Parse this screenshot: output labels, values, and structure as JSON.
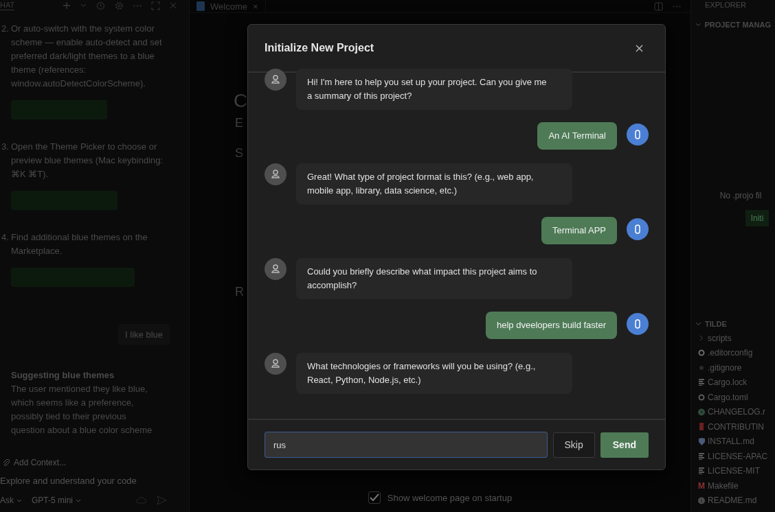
{
  "chat_panel": {
    "tab": "HAT",
    "steps": [
      {
        "number": "2.",
        "text": "Or auto-switch with the system color scheme — enable auto-detect and set preferred dark/light themes to a blue theme (references: window.autoDetectColorScheme)."
      },
      {
        "number": "3.",
        "text": "Open the Theme Picker to choose or preview blue themes (Mac keybinding: ⌘K ⌘T)."
      },
      {
        "number": "4.",
        "text": "Find additional blue themes on the Marketplace."
      }
    ],
    "user_message": "I like blue",
    "thinking": {
      "title": "Suggesting blue themes",
      "text": "The user mentioned they like blue, which seems like a preference, possibly tied to their previous question about a blue color scheme"
    },
    "add_context": "Add Context...",
    "input": {
      "placeholder": "Explore and understand your code"
    },
    "mode": "Ask",
    "model": "GPT-5 mini"
  },
  "editor": {
    "tab": {
      "label": "Welcome",
      "close": "×"
    },
    "fragments": [
      "C",
      "E",
      "S",
      "R"
    ],
    "show_on_startup": {
      "label": "Show welcome page on startup",
      "checked": true
    }
  },
  "explorer": {
    "title": "EXPLORER",
    "sections": [
      {
        "title": "PROJECT MANAG",
        "expanded": true
      },
      {
        "title": "TILDE",
        "expanded": true
      }
    ],
    "empty_text": "No .projo fil",
    "init_button": "Initi",
    "files": [
      {
        "name": "scripts",
        "kind": "folder"
      },
      {
        "name": ".editorconfig",
        "kind": "gear",
        "color": "#6a6a6a"
      },
      {
        "name": ".gitignore",
        "kind": "dot",
        "color": "#2a2a2a"
      },
      {
        "name": "Cargo.lock",
        "kind": "lines",
        "color": "#5a5a5a"
      },
      {
        "name": "Cargo.toml",
        "kind": "gear",
        "color": "#5a5a5a"
      },
      {
        "name": "CHANGELOG.r",
        "kind": "clock",
        "color": "#2f4a3a"
      },
      {
        "name": "CONTRIBUTIN",
        "kind": "bar",
        "color": "#6a1f1f"
      },
      {
        "name": "INSTALL.md",
        "kind": "shield",
        "color": "#4a5a7a"
      },
      {
        "name": "LICENSE-APAC",
        "kind": "lines",
        "color": "#5a5a5a"
      },
      {
        "name": "LICENSE-MIT",
        "kind": "lines",
        "color": "#5a5a5a"
      },
      {
        "name": "Makefile",
        "kind": "letter",
        "icon_text": "M",
        "color": "#8a3030"
      },
      {
        "name": "README.md",
        "kind": "info",
        "color": "#4a4a4a"
      }
    ]
  },
  "dialog": {
    "title": "Initialize New Project",
    "messages": [
      {
        "kind": "assistant",
        "text": "Hi! I'm here to help you set up your project. Can you give me a summary of this project?"
      },
      {
        "kind": "user",
        "text": "An AI Terminal"
      },
      {
        "kind": "assistant",
        "text": "Great! What type of project format is this? (e.g., web app, mobile app, library, data science, etc.)"
      },
      {
        "kind": "user",
        "text": "Terminal APP"
      },
      {
        "kind": "assistant",
        "text": "Could you briefly describe what impact this project aims to accomplish?"
      },
      {
        "kind": "user",
        "text": "help dveelopers build faster"
      },
      {
        "kind": "assistant",
        "text": "What technologies or frameworks will you be using? (e.g., React, Python, Node.js, etc.)"
      }
    ],
    "input": {
      "value": "rus",
      "focused": true
    },
    "buttons": [
      {
        "label": "Skip",
        "kind": "secondary"
      },
      {
        "label": "Send",
        "kind": "primary"
      }
    ]
  }
}
